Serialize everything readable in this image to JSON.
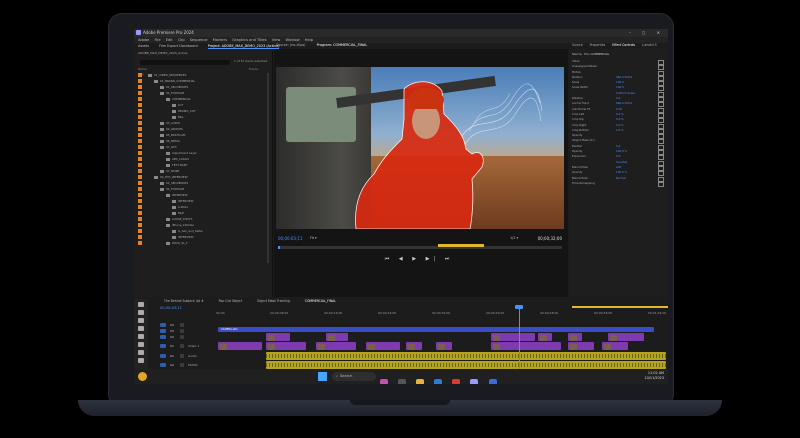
{
  "app": {
    "title": "Adobe Premiere Pro 2024",
    "window_controls": "– ◻ ✕"
  },
  "menu": [
    "Adobe",
    "File",
    "Edit",
    "Clip",
    "Sequence",
    "Markers",
    "Graphics and Titles",
    "View",
    "Window",
    "Help"
  ],
  "workspace_tabs": [
    {
      "label": "Assets",
      "active": false
    },
    {
      "label": "Film Export Dashboard",
      "active": false
    },
    {
      "label": "Project: ADOBE_MAX_DEMO_2023 (Active)",
      "active": true
    }
  ],
  "project": {
    "file_tab": "ADOBE_MAX_DEMO_2023_Active",
    "items_selected": "1 of 5x items selected",
    "col_name": "Name",
    "col_frame": "Frame",
    "bins": [
      {
        "indent": 0,
        "label": "01_VIDEO_SEQUENCES"
      },
      {
        "indent": 1,
        "label": "01_BRAND_COMMERCIAL"
      },
      {
        "indent": 2,
        "label": "01_SEQUENCES"
      },
      {
        "indent": 2,
        "label": "02_FOOTAGE"
      },
      {
        "indent": 3,
        "label": "COMMERCIAL"
      },
      {
        "indent": 4,
        "label": "LUT"
      },
      {
        "indent": 4,
        "label": "PROMO_CUT"
      },
      {
        "indent": 4,
        "label": "B&L"
      },
      {
        "indent": 2,
        "label": "03_AUDIO"
      },
      {
        "indent": 2,
        "label": "04_GROUPS"
      },
      {
        "indent": 2,
        "label": "05_MULTICAM"
      },
      {
        "indent": 2,
        "label": "06_MEDIA"
      },
      {
        "indent": 2,
        "label": "07_GFX"
      },
      {
        "indent": 3,
        "label": "Adjustment Layer"
      },
      {
        "indent": 3,
        "label": "ABC_LOGOS"
      },
      {
        "indent": 3,
        "label": "TEXT BART"
      },
      {
        "indent": 2,
        "label": "07_MORE"
      },
      {
        "indent": 1,
        "label": "02_DTC_INTERVIEW"
      },
      {
        "indent": 2,
        "label": "01_SEQUENCES"
      },
      {
        "indent": 2,
        "label": "02_FOOTAGE"
      },
      {
        "indent": 3,
        "label": "INTERVIEW"
      },
      {
        "indent": 4,
        "label": "INTERVIEW"
      },
      {
        "indent": 4,
        "label": "A-ROLL"
      },
      {
        "indent": 4,
        "label": "B&E"
      },
      {
        "indent": 3,
        "label": "LOOSE_SHOTS"
      },
      {
        "indent": 3,
        "label": "iPhone_10Video"
      },
      {
        "indent": 4,
        "label": "IL_Sell_and_Setbs"
      },
      {
        "indent": 4,
        "label": "INTERVIEW"
      },
      {
        "indent": 3,
        "label": "ROCK_SL_T"
      }
    ]
  },
  "source": {
    "tab_label": "Source: (no clips)",
    "program_tab": "Program: COMMERCIAL_FINAL"
  },
  "program": {
    "timecode_in": "00;00;03;11",
    "timecode_out": "00;00;32;00",
    "zoom": "Fit",
    "quality": "1/2",
    "transport": "⏮ ◀ ▶ ▶| ⏭"
  },
  "effect_controls": {
    "tabs": [
      {
        "label": "Source",
        "active": false
      },
      {
        "label": "Properties",
        "active": false
      },
      {
        "label": "Effect Controls",
        "active": true
      },
      {
        "label": "Lumetri S",
        "active": false
      }
    ],
    "master": "Source · Pro..COMMERCIAL",
    "rows": [
      {
        "label": "Video",
        "value": ""
      },
      {
        "label": "Unassigned Masks",
        "value": ""
      },
      {
        "label": "Motion",
        "value": ""
      },
      {
        "label": "Position",
        "value": "960.0  540.0"
      },
      {
        "label": "Scale",
        "value": "100.0"
      },
      {
        "label": "Scale Width",
        "value": "100.0"
      },
      {
        "label": "",
        "value": "Uniform Scale"
      },
      {
        "label": "Rotation",
        "value": "0.0"
      },
      {
        "label": "Anchor Point",
        "value": "960.0  540.0"
      },
      {
        "label": "Anti-flicker Fil.",
        "value": "0.00"
      },
      {
        "label": "Crop Left",
        "value": "0.0 %"
      },
      {
        "label": "Crop Top",
        "value": "0.0 %"
      },
      {
        "label": "Crop Right",
        "value": "0.0 %"
      },
      {
        "label": "Crop Bottom",
        "value": "0.0 %"
      },
      {
        "label": "Opacity",
        "value": ""
      },
      {
        "label": "Object Mask (Sc)",
        "value": ""
      },
      {
        "label": "Feather",
        "value": "0.0"
      },
      {
        "label": "Opacity",
        "value": "100.0 %"
      },
      {
        "label": "Expansion",
        "value": "0.0"
      },
      {
        "label": "",
        "value": "Inverted"
      },
      {
        "label": "Blend Mode",
        "value": "Add"
      },
      {
        "label": "Opacity",
        "value": "100.0 %"
      },
      {
        "label": "Blend Mode",
        "value": "Normal"
      },
      {
        "label": "Time Remapping",
        "value": ""
      }
    ]
  },
  "timeline": {
    "tabs": [
      {
        "label": "The Behind Subject: Ad #",
        "active": false
      },
      {
        "label": "Pop Out Object",
        "active": false
      },
      {
        "label": "Object Mask Tracking",
        "active": false
      },
      {
        "label": "COMMERCIAL_FINAL",
        "active": true
      }
    ],
    "timecode": "00;00;03;11",
    "ticks": [
      "00;00",
      "00;00;08;00",
      "00;00;16;00",
      "00;00;24;00",
      "00;00;32;00",
      "00;00;40;00",
      "00;00;48;00",
      "00;00;56;00",
      "00;01;04;00"
    ],
    "tracks": [
      {
        "name": "V4",
        "label": ""
      },
      {
        "name": "V3",
        "label": ""
      },
      {
        "name": "V2",
        "label": ""
      },
      {
        "name": "V1",
        "label": "Video 1"
      },
      {
        "name": "A1",
        "label": "Audio"
      },
      {
        "name": "A2",
        "label": "MUSIC"
      }
    ],
    "adjustment_clip": "CAMERA-A01"
  },
  "taskbar": {
    "search_placeholder": "Search",
    "time": "11:02 AM",
    "date": "10/11/2023"
  },
  "colors": {
    "video_clip": "#7e3bb0",
    "adjustment_clip": "#3b4cc7",
    "audio_clip": "#b4a423",
    "accent": "#4a90ff",
    "bin_label": "#e3842d",
    "mask_overlay": "#d82a10"
  }
}
